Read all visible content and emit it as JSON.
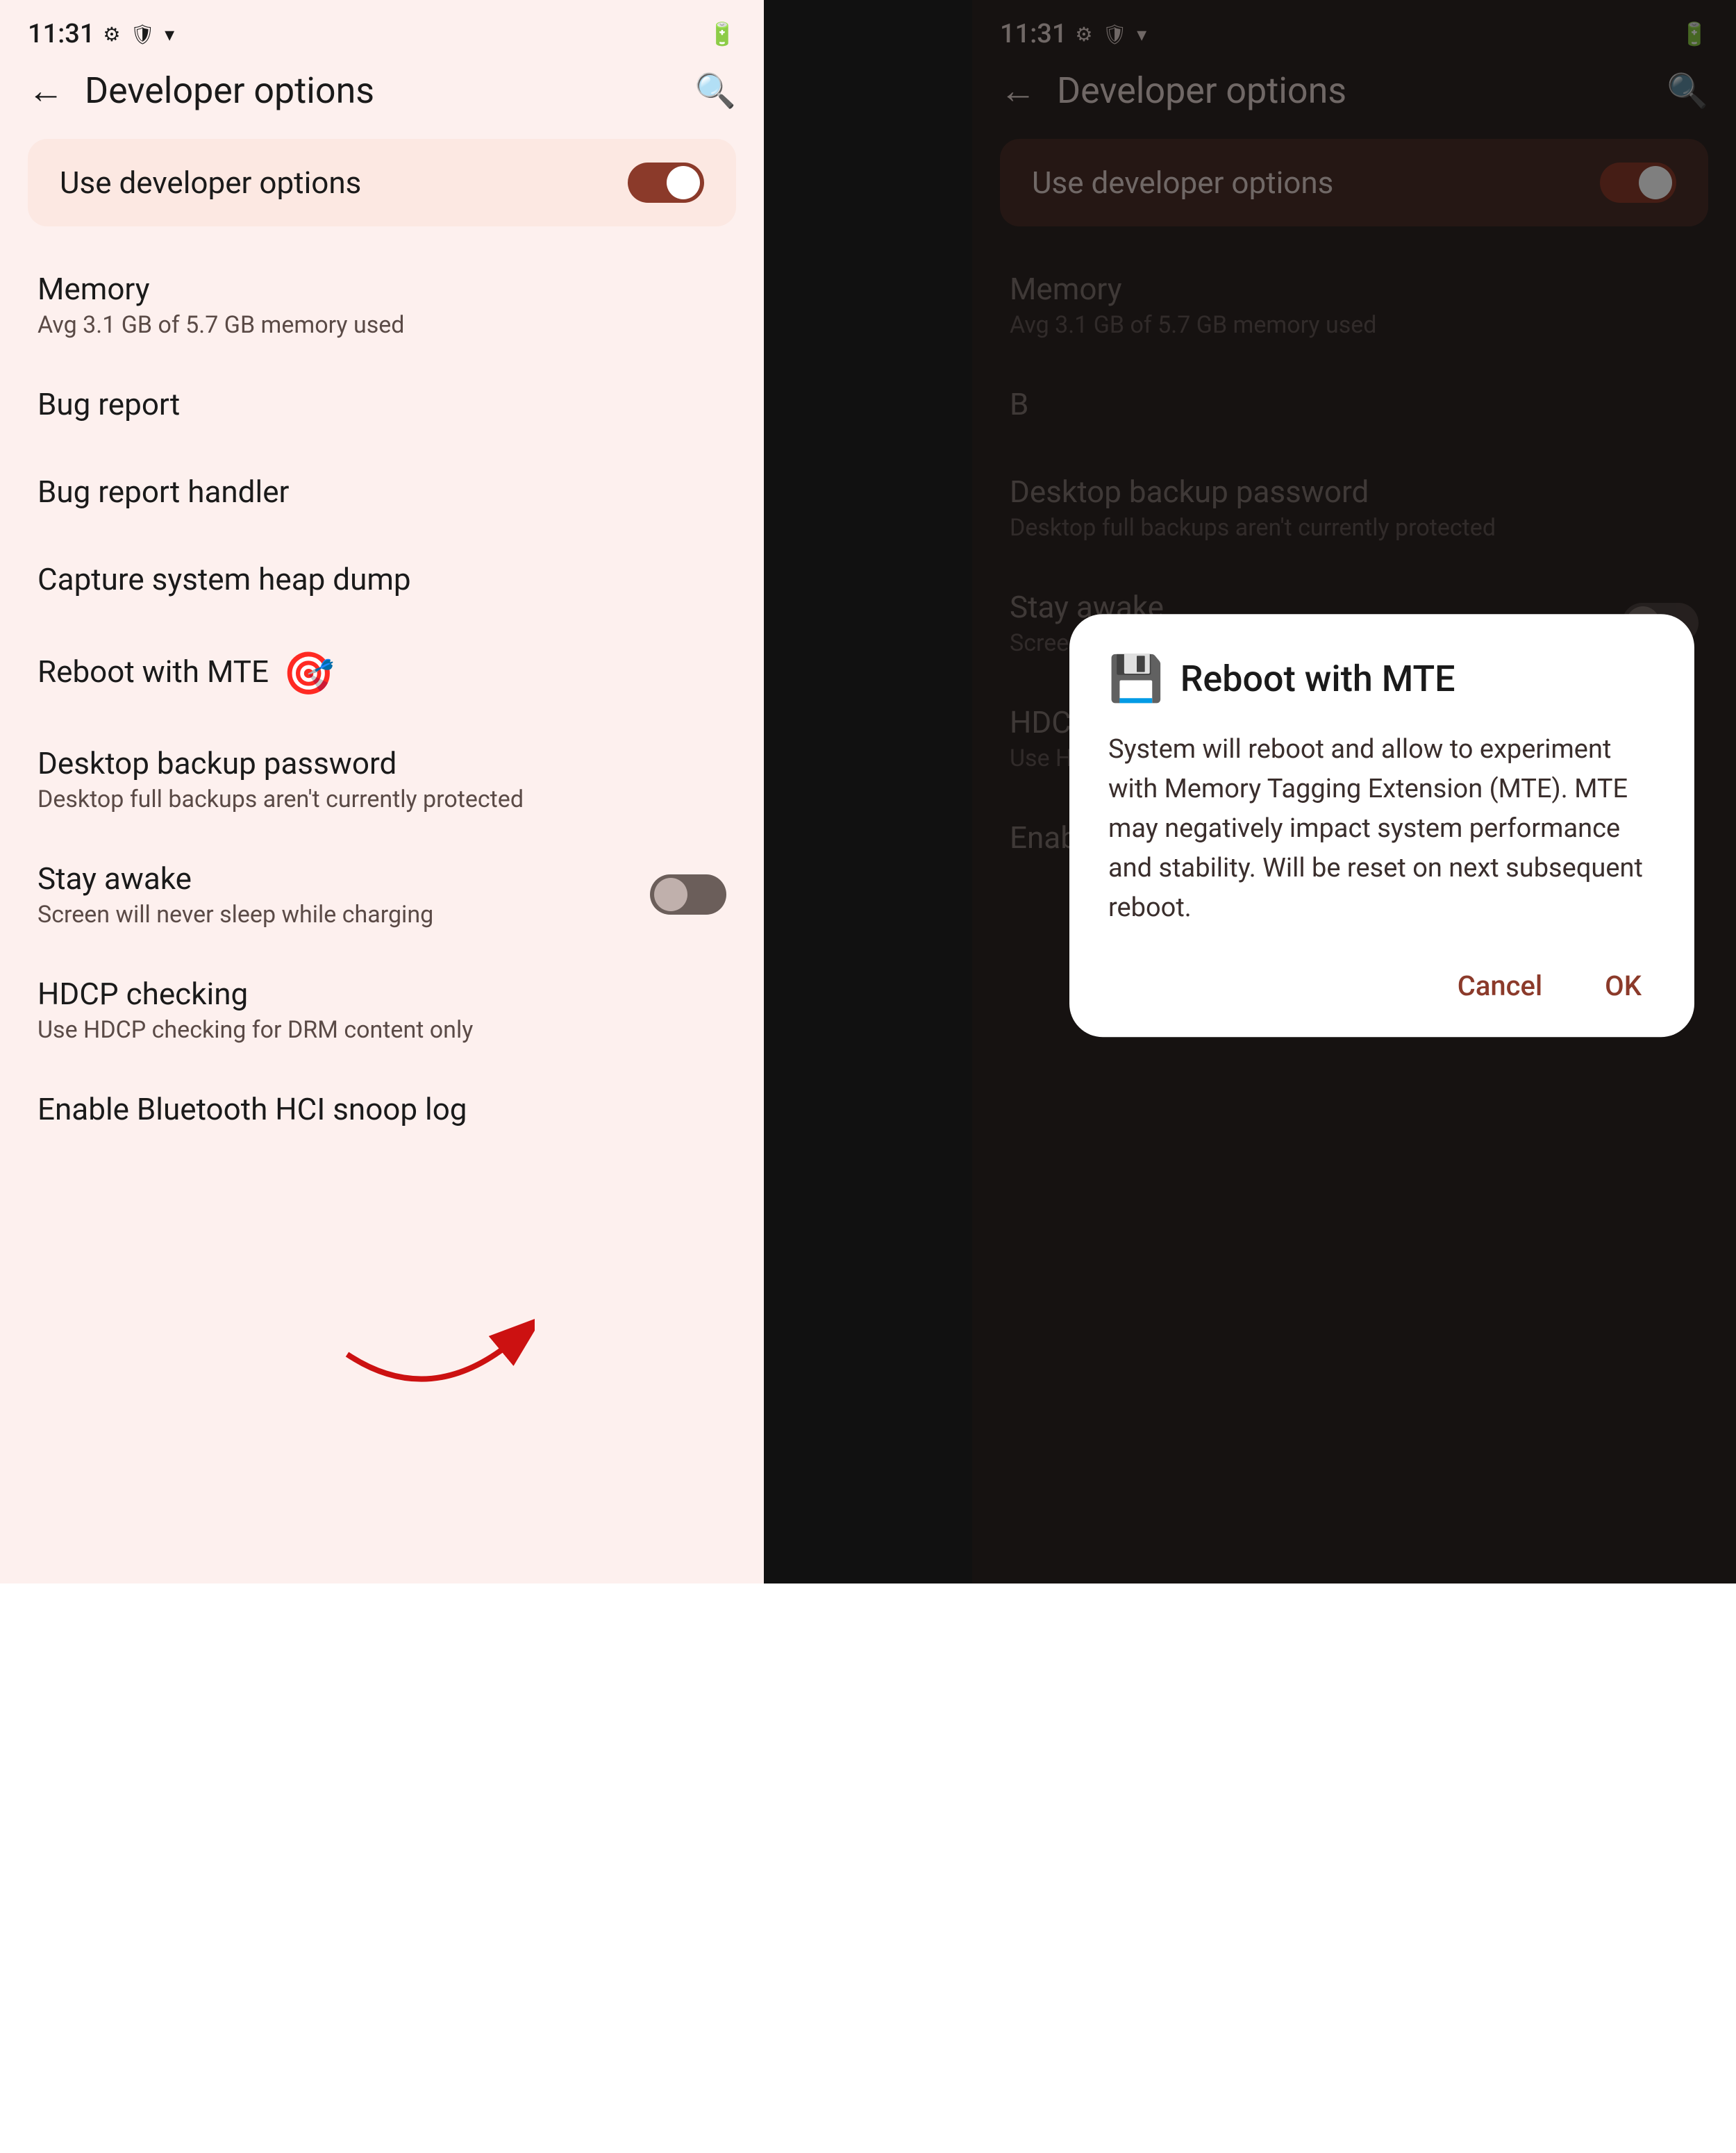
{
  "left": {
    "statusBar": {
      "time": "11:31",
      "batteryIcon": "🔋"
    },
    "header": {
      "backLabel": "←",
      "title": "Developer options",
      "searchLabel": "🔍"
    },
    "devCard": {
      "label": "Use developer options",
      "toggleState": "on"
    },
    "items": [
      {
        "id": "memory",
        "title": "Memory",
        "subtitle": "Avg 3.1 GB of 5.7 GB memory used",
        "hasToggle": false
      },
      {
        "id": "bug-report",
        "title": "Bug report",
        "subtitle": "",
        "hasToggle": false
      },
      {
        "id": "bug-report-handler",
        "title": "Bug report handler",
        "subtitle": "",
        "hasToggle": false
      },
      {
        "id": "capture-heap",
        "title": "Capture system heap dump",
        "subtitle": "",
        "hasToggle": false
      },
      {
        "id": "reboot-mte",
        "title": "Reboot with MTE",
        "subtitle": "",
        "hasToggle": false,
        "hasClickIcon": true
      },
      {
        "id": "desktop-backup",
        "title": "Desktop backup password",
        "subtitle": "Desktop full backups aren't currently protected",
        "hasToggle": false
      },
      {
        "id": "stay-awake",
        "title": "Stay awake",
        "subtitle": "Screen will never sleep while charging",
        "hasToggle": true,
        "toggleState": "off"
      },
      {
        "id": "hdcp-checking",
        "title": "HDCP checking",
        "subtitle": "Use HDCP checking for DRM content only",
        "hasToggle": false
      },
      {
        "id": "bluetooth-hci",
        "title": "Enable Bluetooth HCI snoop log",
        "subtitle": "",
        "hasToggle": false
      }
    ]
  },
  "right": {
    "statusBar": {
      "time": "11:31",
      "batteryIcon": "🔋"
    },
    "header": {
      "backLabel": "←",
      "title": "Developer options",
      "searchLabel": "🔍"
    },
    "devCard": {
      "label": "Use developer options",
      "toggleState": "on"
    },
    "items": [
      {
        "id": "memory",
        "title": "Memory",
        "subtitle": "Avg 3.1 GB of 5.7 GB memory used",
        "hasToggle": false
      },
      {
        "id": "bug-report",
        "title": "B",
        "subtitle": "",
        "hasToggle": false
      },
      {
        "id": "desktop-backup",
        "title": "Desktop backup password",
        "subtitle": "Desktop full backups aren't currently protected",
        "hasToggle": false
      },
      {
        "id": "stay-awake",
        "title": "Stay awake",
        "subtitle": "Screen will never sleep while charging",
        "hasToggle": true,
        "toggleState": "off"
      },
      {
        "id": "hdcp-checking",
        "title": "HDCP checking",
        "subtitle": "Use HDCP checking for DRM content only",
        "hasToggle": false
      },
      {
        "id": "bluetooth-hci",
        "title": "Enable Bluetooth HCI snoop log",
        "subtitle": "",
        "hasToggle": false
      }
    ],
    "dialog": {
      "icon": "💾",
      "title": "Reboot with MTE",
      "body": "System will reboot and allow to experiment with Memory Tagging Extension (MTE). MTE may negatively impact system performance and stability. Will be reset on next subsequent reboot.",
      "cancelLabel": "Cancel",
      "okLabel": "OK"
    }
  }
}
